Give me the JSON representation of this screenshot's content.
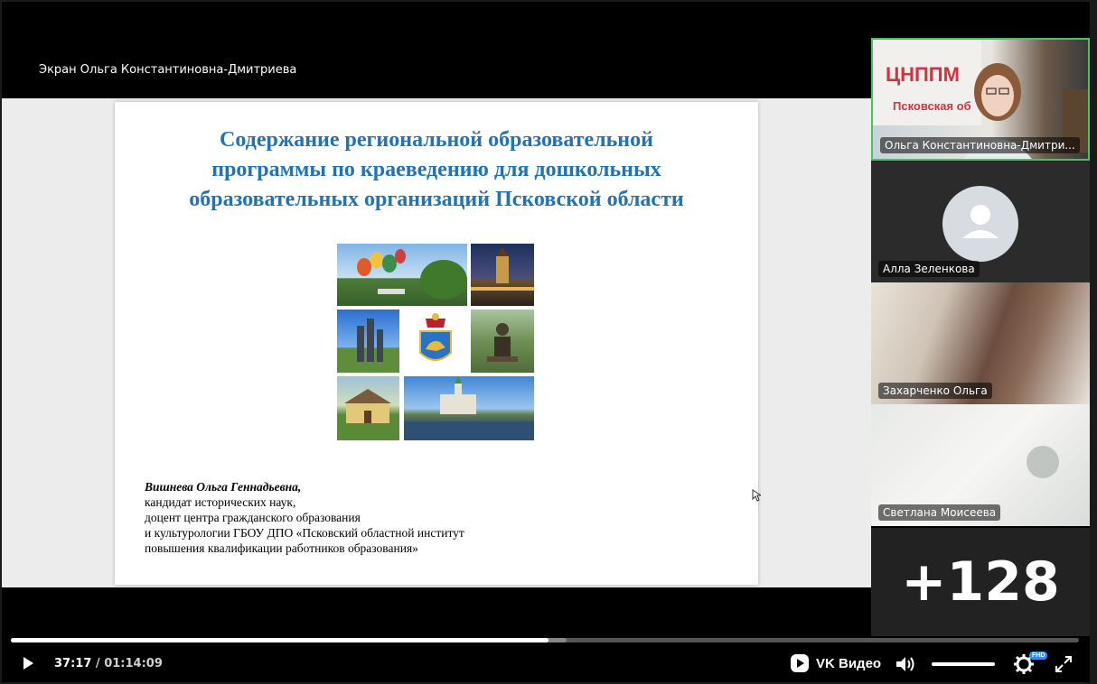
{
  "stage": {
    "screen_owner": "Экран Ольга Константиновна-Дмитриева"
  },
  "slide": {
    "title": "Содержание региональной образовательной программы по краеведению для дошкольных образовательных организаций Псковской области",
    "title_lines": [
      "Содержание региональной образовательной",
      "программы по краеведению для дошкольных",
      "образовательных организаций Псковской области"
    ],
    "author_name": "Вишнева Ольга Геннадьевна",
    "author_lines": [
      "кандидат исторических наук,",
      "доцент центра гражданского образования",
      "и культурологии ГБОУ ДПО «Псковский областной институт",
      "повышения квалификации работников образования»"
    ]
  },
  "participants": [
    {
      "name": "Ольга Константиновна-Дмитри...",
      "speaking": true,
      "banner": "ЦНППМ",
      "banner_sub": "Псковская об"
    },
    {
      "name": "Алла Зеленкова",
      "avatar": "default-avatar"
    },
    {
      "name": "Захарченко Ольга"
    },
    {
      "name": "Светлана Моисеева"
    }
  ],
  "more_participants": "+128",
  "player": {
    "current_time": "37:17",
    "separator": "/",
    "duration": "01:14:09",
    "progress": 0.503,
    "brand": "VK Видео",
    "quality_badge": "FHD",
    "volume": 1.0
  },
  "colors": {
    "title_blue": "#1f73b7",
    "speaking_border": "#48c266",
    "badge_blue": "#2d8cff"
  },
  "icons": [
    "play-icon",
    "vk-video-logo-icon",
    "volume-icon",
    "settings-gear-icon",
    "fullscreen-icon",
    "user-avatar-icon",
    "mouse-cursor-icon"
  ]
}
